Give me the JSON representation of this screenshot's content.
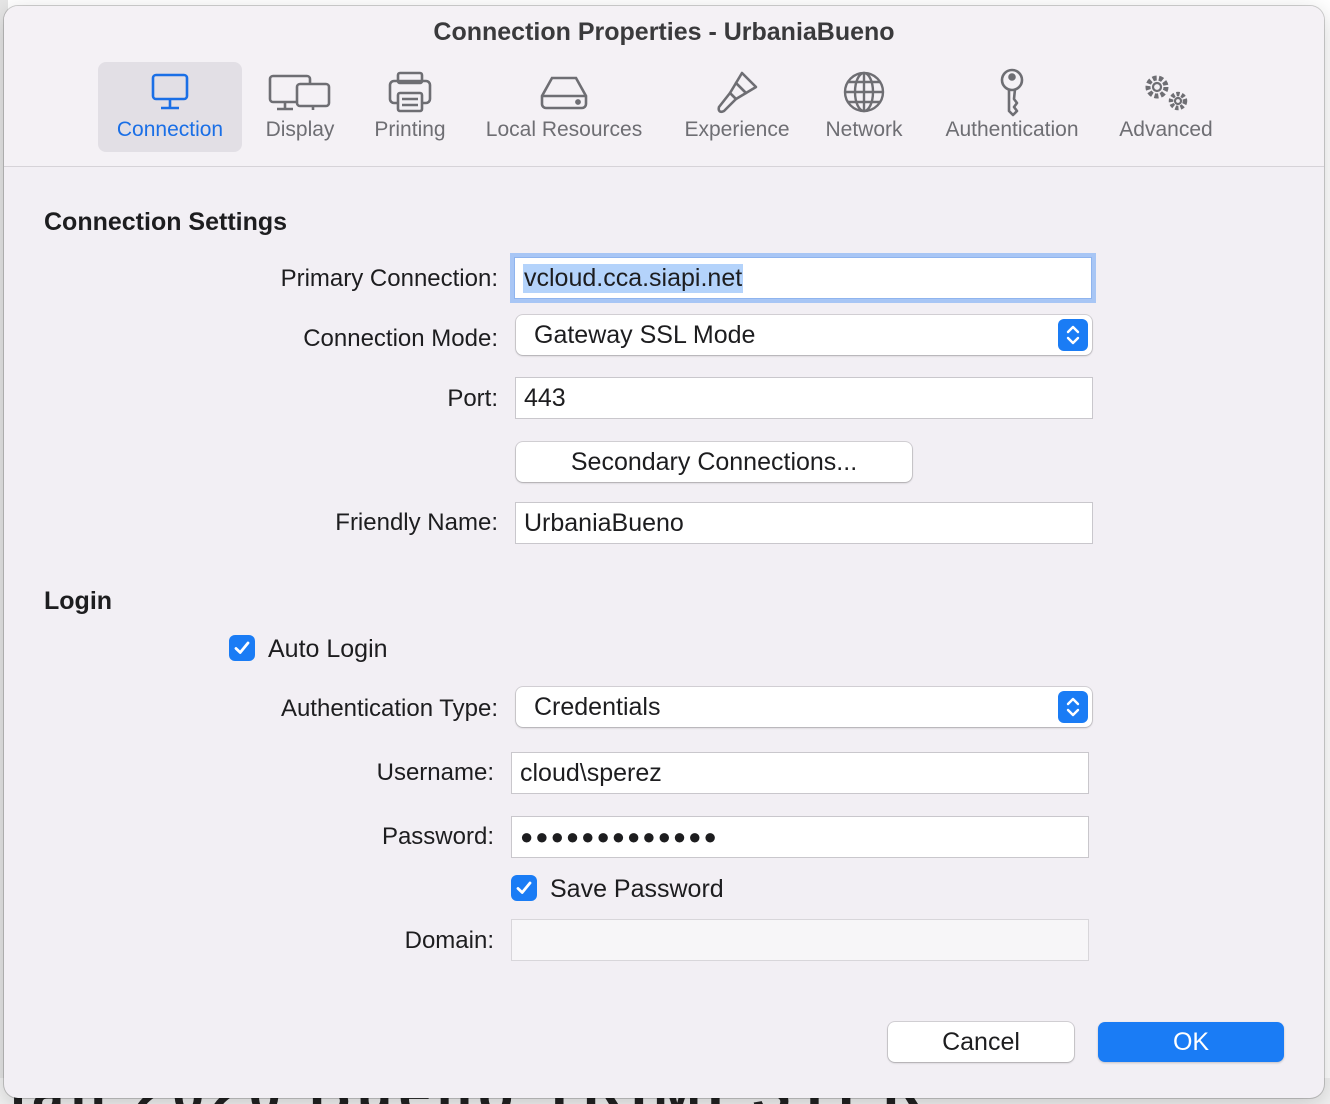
{
  "window": {
    "title": "Connection Properties - UrbaniaBueno"
  },
  "tabs": [
    {
      "label": "Connection",
      "icon": "monitor-icon",
      "active": true
    },
    {
      "label": "Display",
      "icon": "dual-display-icon"
    },
    {
      "label": "Printing",
      "icon": "printer-icon"
    },
    {
      "label": "Local Resources",
      "icon": "drive-icon"
    },
    {
      "label": "Experience",
      "icon": "brush-icon"
    },
    {
      "label": "Network",
      "icon": "globe-icon"
    },
    {
      "label": "Authentication",
      "icon": "key-icon"
    },
    {
      "label": "Advanced",
      "icon": "gears-icon"
    }
  ],
  "connection_settings": {
    "heading": "Connection Settings",
    "primary_label": "Primary Connection:",
    "primary_value": "vcloud.cca.siapi.net",
    "mode_label": "Connection Mode:",
    "mode_value": "Gateway SSL Mode",
    "port_label": "Port:",
    "port_value": "443",
    "secondary_button": "Secondary Connections...",
    "friendly_label": "Friendly Name:",
    "friendly_value": "UrbaniaBueno"
  },
  "login": {
    "heading": "Login",
    "auto_login_label": "Auto Login",
    "auto_login_checked": true,
    "auth_type_label": "Authentication Type:",
    "auth_type_value": "Credentials",
    "username_label": "Username:",
    "username_value": "cloud\\sperez",
    "password_label": "Password:",
    "password_value": "●●●●●●●●●●●●●",
    "save_password_label": "Save Password",
    "save_password_checked": true,
    "domain_label": "Domain:",
    "domain_value": ""
  },
  "footer": {
    "cancel_label": "Cancel",
    "ok_label": "OK"
  },
  "colors": {
    "accent": "#1a7cf5",
    "window_bg": "#f2eff4",
    "selection": "#b4d3fb"
  }
}
